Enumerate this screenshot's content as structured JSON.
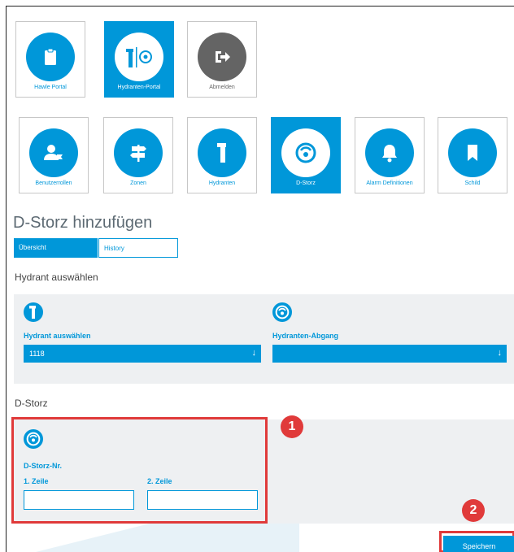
{
  "top_nav": {
    "items": [
      {
        "label": "Hawle Portal",
        "icon": "clipboard-icon",
        "active": false
      },
      {
        "label": "Hydranten-Portal",
        "icon": "hydrant-portal-icon",
        "active": true
      },
      {
        "label": "Abmelden",
        "icon": "logout-icon",
        "active": false
      }
    ]
  },
  "module_nav": {
    "items": [
      {
        "label": "Benutzerrollen",
        "icon": "user-roles-icon",
        "active": false
      },
      {
        "label": "Zonen",
        "icon": "signpost-icon",
        "active": false
      },
      {
        "label": "Hydranten",
        "icon": "hydrant-icon",
        "active": false
      },
      {
        "label": "D-Storz",
        "icon": "storz-coupling-icon",
        "active": true
      },
      {
        "label": "Alarm Definitionen",
        "icon": "bell-icon",
        "active": false
      },
      {
        "label": "Schild",
        "icon": "bookmark-icon",
        "active": false
      }
    ]
  },
  "page": {
    "title": "D-Storz hinzufügen",
    "tabs": [
      {
        "label": "Übersicht",
        "selected": true
      },
      {
        "label": "History",
        "selected": false
      }
    ]
  },
  "hydrant_section": {
    "heading": "Hydrant auswählen",
    "hydrant_label": "Hydrant auswählen",
    "hydrant_value": "1118",
    "outlet_label": "Hydranten-Abgang",
    "outlet_value": ""
  },
  "storz_section": {
    "heading": "D-Storz",
    "number_label": "D-Storz-Nr.",
    "line1_label": "1. Zeile",
    "line1_value": "",
    "line2_label": "2. Zeile",
    "line2_value": ""
  },
  "annotations": {
    "marker1": "1",
    "marker2": "2",
    "color": "#e03a3a"
  },
  "actions": {
    "save_label": "Speichern"
  },
  "colors": {
    "accent": "#0097d9",
    "panel": "#eef0f2",
    "logout": "#646464"
  }
}
